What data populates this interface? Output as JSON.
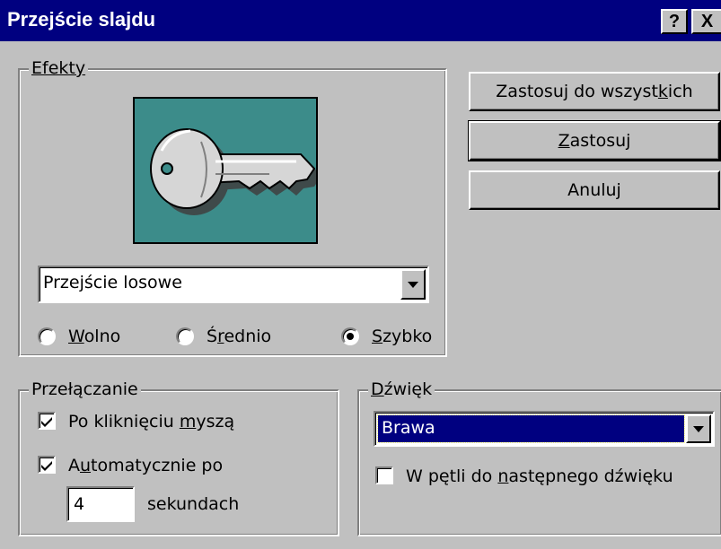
{
  "dialog": {
    "title": "Przejście slajdu",
    "help_label": "?",
    "close_label": "X"
  },
  "effects": {
    "group_label": "Efekty",
    "preview_icon": "key-icon",
    "selected_effect": "Przejście losowe",
    "speed_options": [
      {
        "label": "Wolno",
        "selected": false
      },
      {
        "label": "Średnio",
        "selected": false
      },
      {
        "label": "Szybko",
        "selected": true
      }
    ]
  },
  "advance": {
    "group_label": "Przełączanie",
    "on_click": {
      "label": "Po kliknięciu myszą",
      "checked": true
    },
    "automatic": {
      "label": "Automatycznie po",
      "checked": true
    },
    "seconds_value": "4",
    "seconds_unit": "sekundach"
  },
  "sound": {
    "group_label": "Dźwięk",
    "selected_sound": "Brawa",
    "loop": {
      "label": "W pętli do następnego dźwięku",
      "checked": false
    }
  },
  "buttons": {
    "apply_all": "Zastosuj do wszystkich",
    "apply": "Zastosuj",
    "cancel": "Anuluj"
  },
  "colors": {
    "titlebar": "#000080",
    "dialog_bg": "#c0c0c0",
    "preview_bg": "#3c8c8a",
    "selection": "#000080"
  }
}
